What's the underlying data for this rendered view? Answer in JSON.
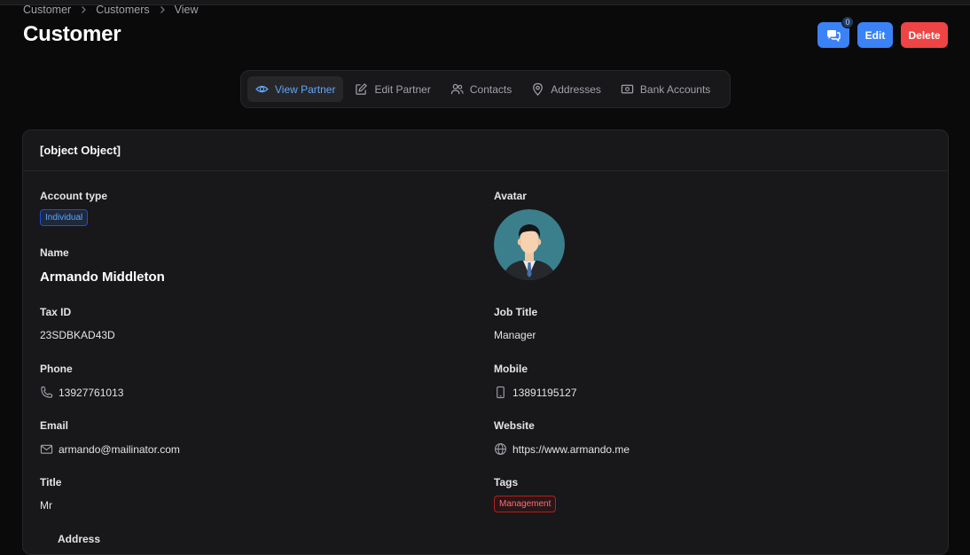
{
  "breadcrumb": {
    "items": [
      "Customer",
      "Customers",
      "View"
    ]
  },
  "page": {
    "title": "Customer"
  },
  "actions": {
    "chat_count": "0",
    "edit_label": "Edit",
    "delete_label": "Delete"
  },
  "tabs": [
    {
      "label": "View Partner",
      "icon": "eye-icon",
      "active": true
    },
    {
      "label": "Edit Partner",
      "icon": "pencil-square-icon",
      "active": false
    },
    {
      "label": "Contacts",
      "icon": "users-icon",
      "active": false
    },
    {
      "label": "Addresses",
      "icon": "map-pin-icon",
      "active": false
    },
    {
      "label": "Bank Accounts",
      "icon": "banknotes-icon",
      "active": false
    }
  ],
  "section": {
    "title": {
      "label": "Title",
      "value": "Mr"
    },
    "account_type": {
      "label": "Account type",
      "value": "Individual"
    },
    "avatar": {
      "label": "Avatar"
    },
    "name": {
      "label": "Name",
      "value": "Armando Middleton"
    },
    "tax_id": {
      "label": "Tax ID",
      "value": "23SDBKAD43D"
    },
    "job_title": {
      "label": "Job Title",
      "value": "Manager"
    },
    "phone": {
      "label": "Phone",
      "value": "13927761013"
    },
    "mobile": {
      "label": "Mobile",
      "value": "13891195127"
    },
    "email": {
      "label": "Email",
      "value": "armando@mailinator.com"
    },
    "website": {
      "label": "Website",
      "value": "https://www.armando.me"
    },
    "tags": {
      "label": "Tags",
      "values": [
        "Management"
      ]
    },
    "address": {
      "label": "Address"
    }
  },
  "colors": {
    "primary": "#3b82f6",
    "danger": "#ef4444",
    "background": "#0a0a0b",
    "card": "#18181b"
  }
}
